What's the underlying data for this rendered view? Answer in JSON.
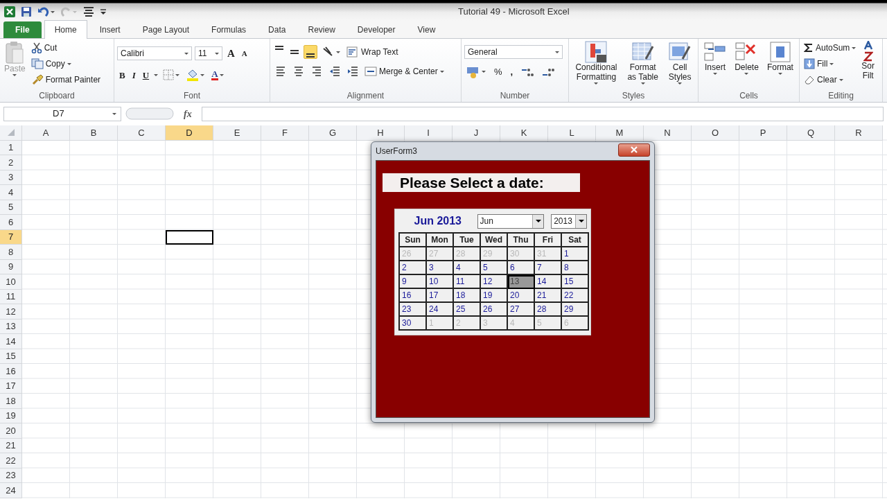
{
  "window": {
    "title": "Tutorial 49  -  Microsoft Excel"
  },
  "tabs": [
    {
      "label": "File",
      "kind": "file",
      "selected": false
    },
    {
      "label": "Home",
      "kind": "tab",
      "selected": true
    },
    {
      "label": "Insert",
      "kind": "tab",
      "selected": false
    },
    {
      "label": "Page Layout",
      "kind": "tab",
      "selected": false
    },
    {
      "label": "Formulas",
      "kind": "tab",
      "selected": false
    },
    {
      "label": "Data",
      "kind": "tab",
      "selected": false
    },
    {
      "label": "Review",
      "kind": "tab",
      "selected": false
    },
    {
      "label": "Developer",
      "kind": "tab",
      "selected": false
    },
    {
      "label": "View",
      "kind": "tab",
      "selected": false
    }
  ],
  "ribbon": {
    "clipboard": {
      "label": "Clipboard",
      "paste": "Paste",
      "cut": "Cut",
      "copy": "Copy",
      "format_painter": "Format Painter"
    },
    "font": {
      "label": "Font",
      "font_name": "Calibri",
      "font_size": "11",
      "grow": "A",
      "shrink": "A",
      "bold": "B",
      "italic": "I",
      "underline": "U",
      "font_color": "A"
    },
    "alignment": {
      "label": "Alignment",
      "vertical_align": [
        {
          "selected": false
        },
        {
          "selected": false
        },
        {
          "selected": true
        }
      ],
      "wrap_text": "Wrap Text",
      "merge_center": "Merge & Center"
    },
    "number": {
      "label": "Number",
      "format": "General",
      "percent": "%",
      "comma": ","
    },
    "styles": {
      "label": "Styles",
      "buttons": [
        "Conditional\nFormatting",
        "Format\nas Table",
        "Cell\nStyles"
      ]
    },
    "cells": {
      "label": "Cells",
      "buttons": [
        "Insert",
        "Delete",
        "Format"
      ]
    },
    "editing": {
      "label": "Editing",
      "autosum": "AutoSum",
      "fill": "Fill",
      "clear": "Clear",
      "sort": "Sor\nFilt"
    }
  },
  "formula_bar": {
    "name_box": "D7",
    "function_label": "fx"
  },
  "sheet": {
    "columns": [
      {
        "label": "A",
        "selected": false
      },
      {
        "label": "B",
        "selected": false
      },
      {
        "label": "C",
        "selected": false
      },
      {
        "label": "D",
        "selected": true
      },
      {
        "label": "E",
        "selected": false
      },
      {
        "label": "F",
        "selected": false
      },
      {
        "label": "G",
        "selected": false
      },
      {
        "label": "H",
        "selected": false
      },
      {
        "label": "I",
        "selected": false
      },
      {
        "label": "J",
        "selected": false
      },
      {
        "label": "K",
        "selected": false
      },
      {
        "label": "L",
        "selected": false
      },
      {
        "label": "M",
        "selected": false
      },
      {
        "label": "N",
        "selected": false
      },
      {
        "label": "O",
        "selected": false
      },
      {
        "label": "P",
        "selected": false
      },
      {
        "label": "Q",
        "selected": false
      },
      {
        "label": "R",
        "selected": false
      }
    ],
    "rows": [
      {
        "label": "1",
        "selected": false
      },
      {
        "label": "2",
        "selected": false
      },
      {
        "label": "3",
        "selected": false
      },
      {
        "label": "4",
        "selected": false
      },
      {
        "label": "5",
        "selected": false
      },
      {
        "label": "6",
        "selected": false
      },
      {
        "label": "7",
        "selected": true
      },
      {
        "label": "8",
        "selected": false
      },
      {
        "label": "9",
        "selected": false
      },
      {
        "label": "10",
        "selected": false
      },
      {
        "label": "11",
        "selected": false
      },
      {
        "label": "12",
        "selected": false
      },
      {
        "label": "13",
        "selected": false
      },
      {
        "label": "14",
        "selected": false
      },
      {
        "label": "15",
        "selected": false
      },
      {
        "label": "16",
        "selected": false
      },
      {
        "label": "17",
        "selected": false
      },
      {
        "label": "18",
        "selected": false
      },
      {
        "label": "19",
        "selected": false
      },
      {
        "label": "20",
        "selected": false
      },
      {
        "label": "21",
        "selected": false
      },
      {
        "label": "22",
        "selected": false
      },
      {
        "label": "23",
        "selected": false
      },
      {
        "label": "24",
        "selected": false
      }
    ]
  },
  "form": {
    "title": "UserForm3",
    "heading": "Please Select a date:",
    "calendar": {
      "caption": "Jun 2013",
      "month": "Jun",
      "year": "2013",
      "weekdays": [
        "Sun",
        "Mon",
        "Tue",
        "Wed",
        "Thu",
        "Fri",
        "Sat"
      ],
      "weeks": [
        [
          {
            "day": "26",
            "other_month": true,
            "selected": false
          },
          {
            "day": "27",
            "other_month": true,
            "selected": false
          },
          {
            "day": "28",
            "other_month": true,
            "selected": false
          },
          {
            "day": "29",
            "other_month": true,
            "selected": false
          },
          {
            "day": "30",
            "other_month": true,
            "selected": false
          },
          {
            "day": "31",
            "other_month": true,
            "selected": false
          },
          {
            "day": "1",
            "other_month": false,
            "selected": false
          }
        ],
        [
          {
            "day": "2",
            "other_month": false,
            "selected": false
          },
          {
            "day": "3",
            "other_month": false,
            "selected": false
          },
          {
            "day": "4",
            "other_month": false,
            "selected": false
          },
          {
            "day": "5",
            "other_month": false,
            "selected": false
          },
          {
            "day": "6",
            "other_month": false,
            "selected": false
          },
          {
            "day": "7",
            "other_month": false,
            "selected": false
          },
          {
            "day": "8",
            "other_month": false,
            "selected": false
          }
        ],
        [
          {
            "day": "9",
            "other_month": false,
            "selected": false
          },
          {
            "day": "10",
            "other_month": false,
            "selected": false
          },
          {
            "day": "11",
            "other_month": false,
            "selected": false
          },
          {
            "day": "12",
            "other_month": false,
            "selected": false
          },
          {
            "day": "13",
            "other_month": false,
            "selected": true
          },
          {
            "day": "14",
            "other_month": false,
            "selected": false
          },
          {
            "day": "15",
            "other_month": false,
            "selected": false
          }
        ],
        [
          {
            "day": "16",
            "other_month": false,
            "selected": false
          },
          {
            "day": "17",
            "other_month": false,
            "selected": false
          },
          {
            "day": "18",
            "other_month": false,
            "selected": false
          },
          {
            "day": "19",
            "other_month": false,
            "selected": false
          },
          {
            "day": "20",
            "other_month": false,
            "selected": false
          },
          {
            "day": "21",
            "other_month": false,
            "selected": false
          },
          {
            "day": "22",
            "other_month": false,
            "selected": false
          }
        ],
        [
          {
            "day": "23",
            "other_month": false,
            "selected": false
          },
          {
            "day": "24",
            "other_month": false,
            "selected": false
          },
          {
            "day": "25",
            "other_month": false,
            "selected": false
          },
          {
            "day": "26",
            "other_month": false,
            "selected": false
          },
          {
            "day": "27",
            "other_month": false,
            "selected": false
          },
          {
            "day": "28",
            "other_month": false,
            "selected": false
          },
          {
            "day": "29",
            "other_month": false,
            "selected": false
          }
        ],
        [
          {
            "day": "30",
            "other_month": false,
            "selected": false
          },
          {
            "day": "1",
            "other_month": true,
            "selected": false
          },
          {
            "day": "2",
            "other_month": true,
            "selected": false
          },
          {
            "day": "3",
            "other_month": true,
            "selected": false
          },
          {
            "day": "4",
            "other_month": true,
            "selected": false
          },
          {
            "day": "5",
            "other_month": true,
            "selected": false
          },
          {
            "day": "6",
            "other_month": true,
            "selected": false
          }
        ]
      ]
    }
  }
}
